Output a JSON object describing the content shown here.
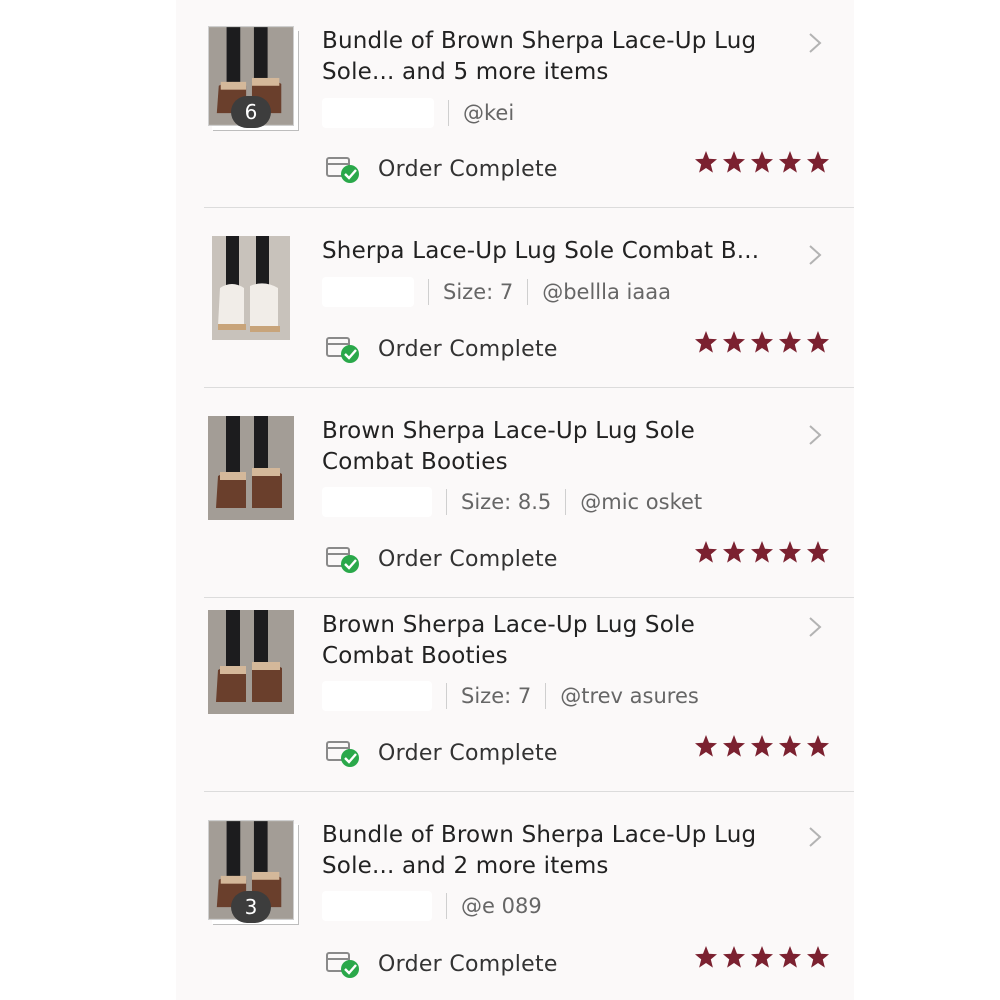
{
  "colors": {
    "star": "#7b2130",
    "status_check": "#2aa84a",
    "text": "#222222",
    "muted": "#666666"
  },
  "orders": [
    {
      "title": "Bundle of Brown Sherpa Lace-Up Lug Sole... and 5 more items",
      "size": "",
      "username": "@kei",
      "bundle_count": "6",
      "status": "Order Complete",
      "rating": 5,
      "thumb": "brown-boots"
    },
    {
      "title": "Sherpa Lace-Up Lug Sole Combat B...",
      "size": "Size: 7",
      "username": "@bellla      iaaa",
      "bundle_count": "",
      "status": "Order Complete",
      "rating": 5,
      "thumb": "white-boots"
    },
    {
      "title": "Brown Sherpa Lace-Up Lug Sole Combat Booties",
      "size": "Size: 8.5",
      "username": "@mic       osket",
      "bundle_count": "",
      "status": "Order Complete",
      "rating": 5,
      "thumb": "brown-boots"
    },
    {
      "title": "Brown Sherpa Lace-Up Lug Sole Combat Booties",
      "size": "Size: 7",
      "username": "@trev        asures",
      "bundle_count": "",
      "status": "Order Complete",
      "rating": 5,
      "thumb": "brown-boots"
    },
    {
      "title": "Bundle of Brown Sherpa Lace-Up Lug Sole... and 2 more items",
      "size": "",
      "username": "@e     089",
      "bundle_count": "3",
      "status": "Order Complete",
      "rating": 5,
      "thumb": "brown-boots"
    }
  ]
}
